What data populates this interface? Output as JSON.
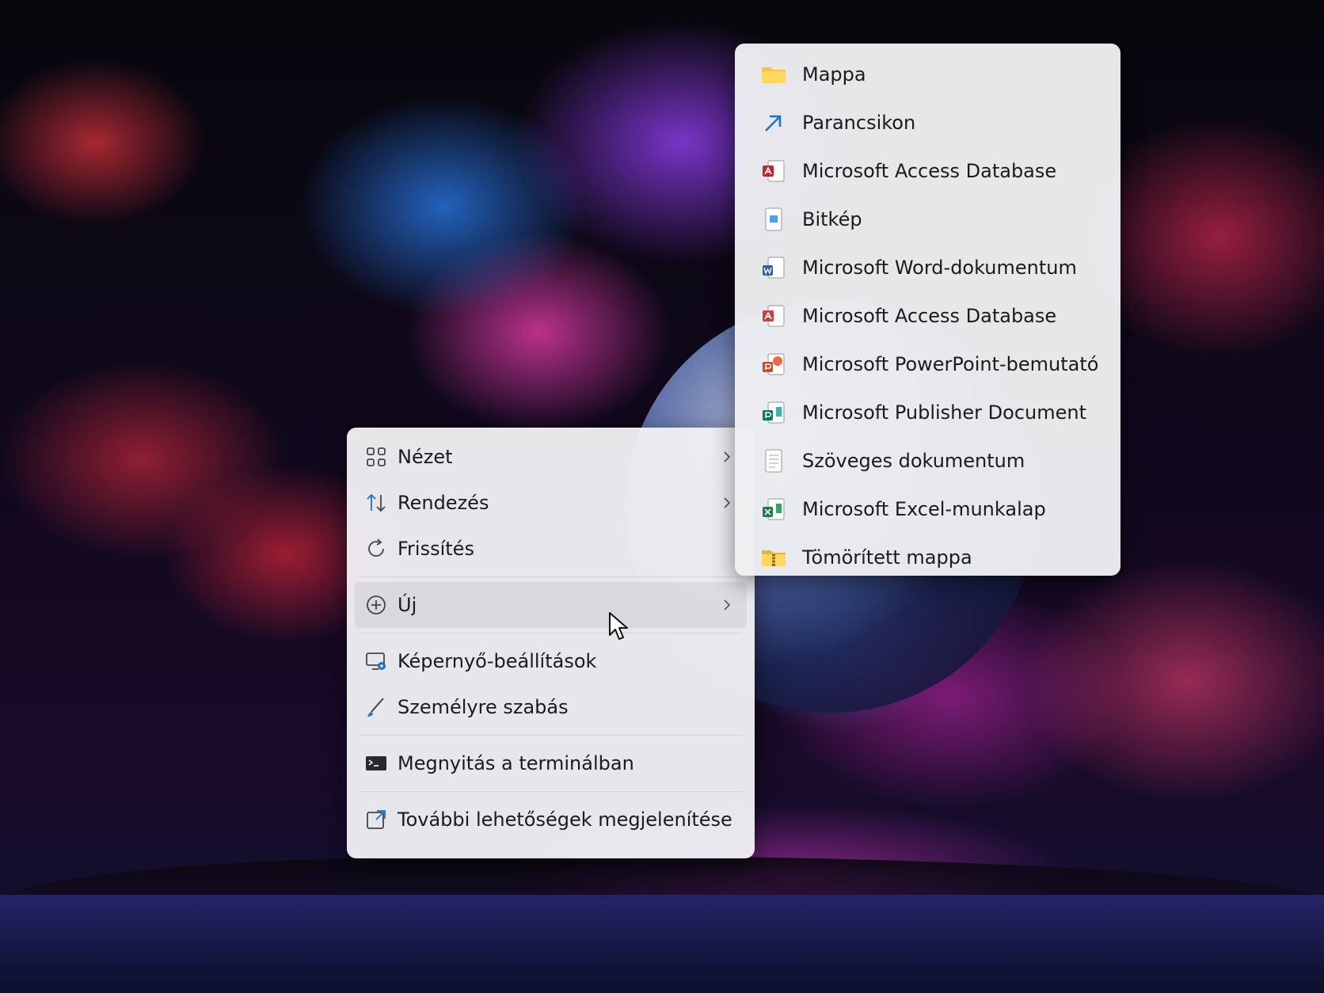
{
  "main_menu": {
    "items": [
      {
        "label": "Nézet",
        "icon": "grid-icon",
        "has_submenu": true
      },
      {
        "label": "Rendezés",
        "icon": "sort-icon",
        "has_submenu": true
      },
      {
        "label": "Frissítés",
        "icon": "refresh-icon",
        "has_submenu": false
      },
      {
        "label": "Új",
        "icon": "plus-circle-icon",
        "has_submenu": true
      },
      {
        "label": "Képernyő-beállítások",
        "icon": "display-settings-icon",
        "has_submenu": false
      },
      {
        "label": "Személyre szabás",
        "icon": "brush-icon",
        "has_submenu": false
      },
      {
        "label": "Megnyitás a terminálban",
        "icon": "terminal-icon",
        "has_submenu": false
      },
      {
        "label": "További lehetőségek megjelenítése",
        "icon": "expand-icon",
        "has_submenu": false
      }
    ]
  },
  "submenu_new": {
    "items": [
      {
        "label": "Mappa",
        "icon": "folder-icon"
      },
      {
        "label": "Parancsikon",
        "icon": "shortcut-arrow-icon"
      },
      {
        "label": "Microsoft Access Database",
        "icon": "access-icon"
      },
      {
        "label": "Bitkép",
        "icon": "bitmap-icon"
      },
      {
        "label": "Microsoft Word-dokumentum",
        "icon": "word-icon"
      },
      {
        "label": "Microsoft Access Database",
        "icon": "access-icon"
      },
      {
        "label": "Microsoft PowerPoint-bemutató",
        "icon": "powerpoint-icon"
      },
      {
        "label": "Microsoft Publisher Document",
        "icon": "publisher-icon"
      },
      {
        "label": "Szöveges dokumentum",
        "icon": "text-document-icon"
      },
      {
        "label": "Microsoft Excel-munkalap",
        "icon": "excel-icon"
      },
      {
        "label": "Tömörített mappa",
        "icon": "zip-folder-icon"
      }
    ]
  },
  "colors": {
    "menu_bg": "#eeeef2",
    "text": "#1b1b1b",
    "accent_blue": "#1a73c9",
    "folder_yellow": "#f6c343",
    "access_red": "#b52a2a",
    "word_blue": "#2b5eb5",
    "powerpoint_orange": "#d24726",
    "publisher_teal": "#077568",
    "excel_green": "#1f7a44"
  }
}
